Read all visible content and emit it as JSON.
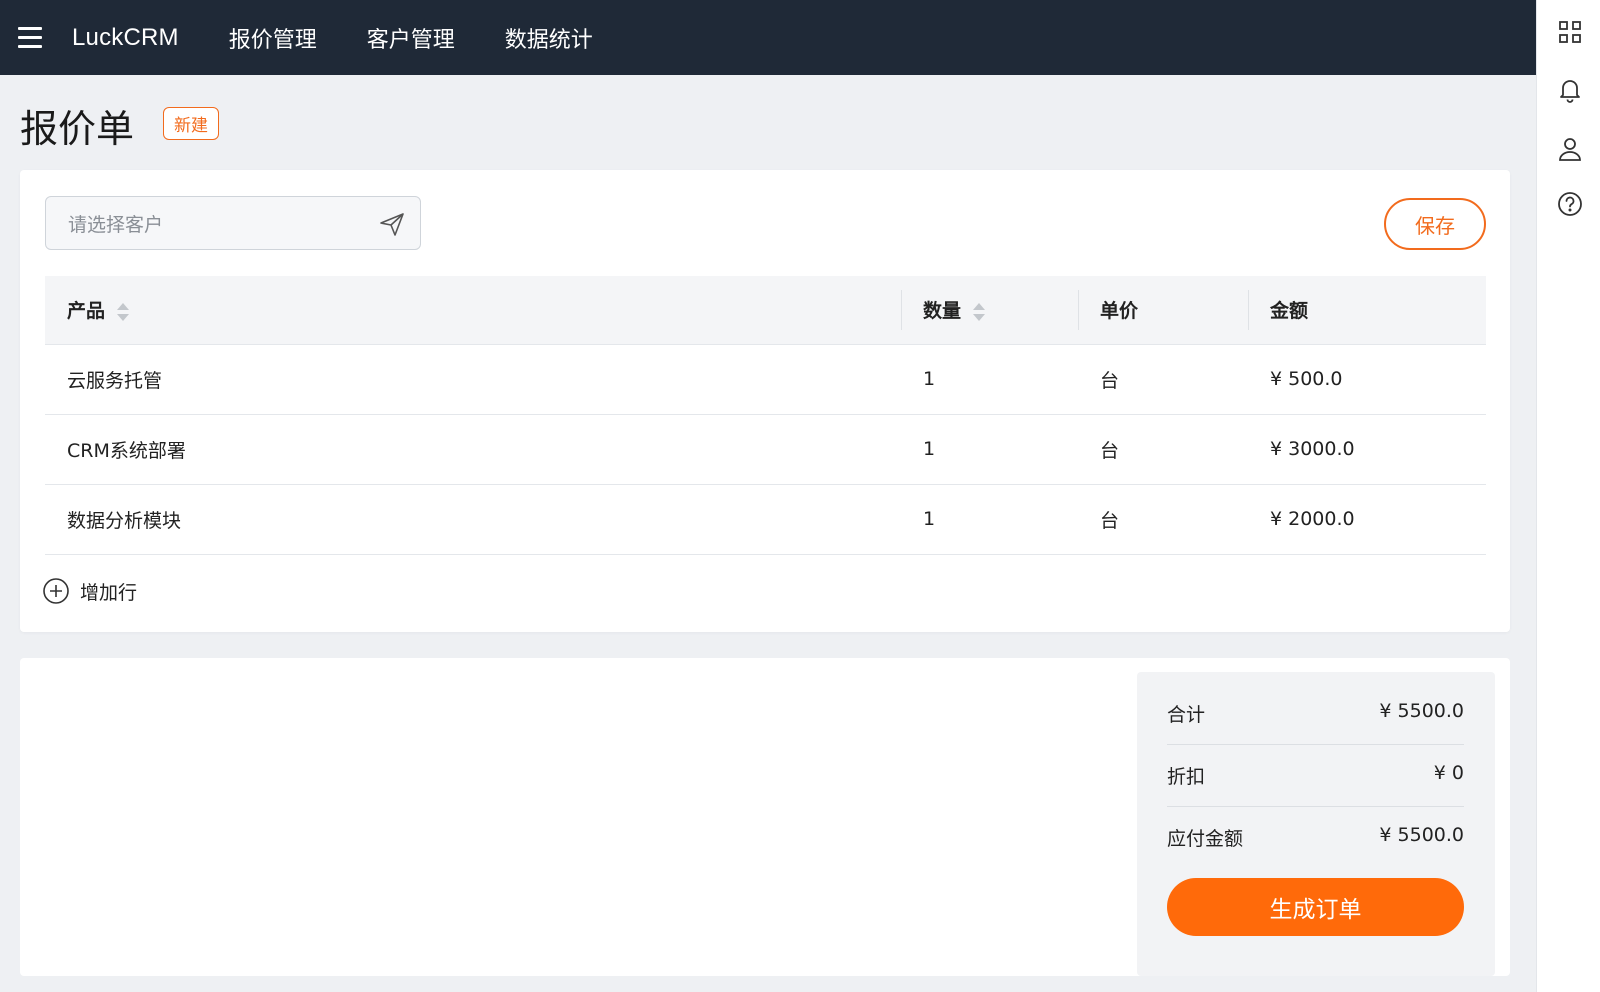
{
  "app": {
    "brand": "LuckCRM",
    "nav": [
      {
        "label": "报价管理"
      },
      {
        "label": "客户管理"
      },
      {
        "label": "数据统计"
      }
    ]
  },
  "rail": {
    "icons": [
      "grid-icon",
      "bell-icon",
      "user-icon",
      "help-icon"
    ]
  },
  "page": {
    "title": "报价单",
    "status": "新建"
  },
  "form": {
    "customer_placeholder": "请选择客户",
    "save_label": "保存"
  },
  "table": {
    "headers": {
      "product": "产品",
      "quantity": "数量",
      "unit": "单价",
      "amount": "金额"
    },
    "rows": [
      {
        "product": "云服务托管",
        "quantity": "1",
        "unit": "台",
        "amount": "¥ 500.0"
      },
      {
        "product": "CRM系统部署",
        "quantity": "1",
        "unit": "台",
        "amount": "¥ 3000.0"
      },
      {
        "product": "数据分析模块",
        "quantity": "1",
        "unit": "台",
        "amount": "¥ 2000.0"
      }
    ],
    "add_row_label": "增加行"
  },
  "summary": {
    "total_label": "合计",
    "total_value": "¥ 5500.0",
    "discount_label": "折扣",
    "discount_value": "¥ 0",
    "payable_label": "应付金额",
    "payable_value": "¥ 5500.0",
    "generate_label": "生成订单"
  },
  "colors": {
    "topbar": "#1f2937",
    "accent": "#ff6a0a",
    "accent_border": "#f26b1d",
    "background": "#eef0f3"
  }
}
